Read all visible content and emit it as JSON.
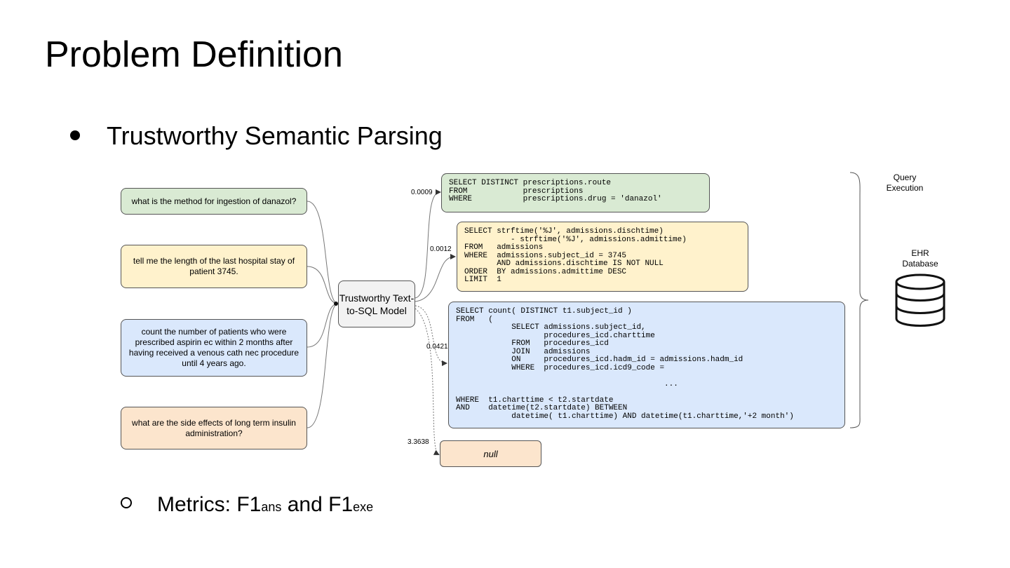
{
  "slide": {
    "title": "Problem Definition",
    "bullet": "Trustworthy Semantic Parsing",
    "metrics_prefix": "Metrics: F1",
    "metrics_sub1": "ans",
    "metrics_mid": " and F1",
    "metrics_sub2": "exe"
  },
  "diagram": {
    "questions": [
      "what is the method for ingestion of danazol?",
      "tell me the length of the last hospital stay of patient 3745.",
      "count the number of patients who were prescribed aspirin ec within 2 months after having received a venous cath nec procedure until 4 years ago.",
      "what are the side effects of long term insulin administration?"
    ],
    "model": "Trustworthy Text-to-SQL Model",
    "scores": [
      "0.0009",
      "0.0012",
      "0.0421",
      "3.3638"
    ],
    "sql": [
      "SELECT DISTINCT prescriptions.route\nFROM            prescriptions\nWHERE           prescriptions.drug = 'danazol'",
      "SELECT strftime('%J', admissions.dischtime)\n          - strftime('%J', admissions.admittime)\nFROM   admissions\nWHERE  admissions.subject_id = 3745\n       AND admissions.dischtime IS NOT NULL\nORDER  BY admissions.admittime DESC\nLIMIT  1",
      "SELECT count( DISTINCT t1.subject_id )\nFROM   (\n            SELECT admissions.subject_id,\n                   procedures_icd.charttime\n            FROM   procedures_icd\n            JOIN   admissions\n            ON     procedures_icd.hadm_id = admissions.hadm_id\n            WHERE  procedures_icd.icd9_code =\n\n                                             ...\n\nWHERE  t1.charttime < t2.startdate\nAND    datetime(t2.startdate) BETWEEN\n            datetime( t1.charttime) AND datetime(t1.charttime,'+2 month')"
    ],
    "null_output": "null",
    "query_execution": "Query Execution",
    "database": "EHR Database"
  },
  "colors": {
    "green": "#d9ead3",
    "yellow": "#fff2cc",
    "blue": "#dae8fc",
    "orange": "#fce5cd",
    "model": "#f2f2f2"
  }
}
